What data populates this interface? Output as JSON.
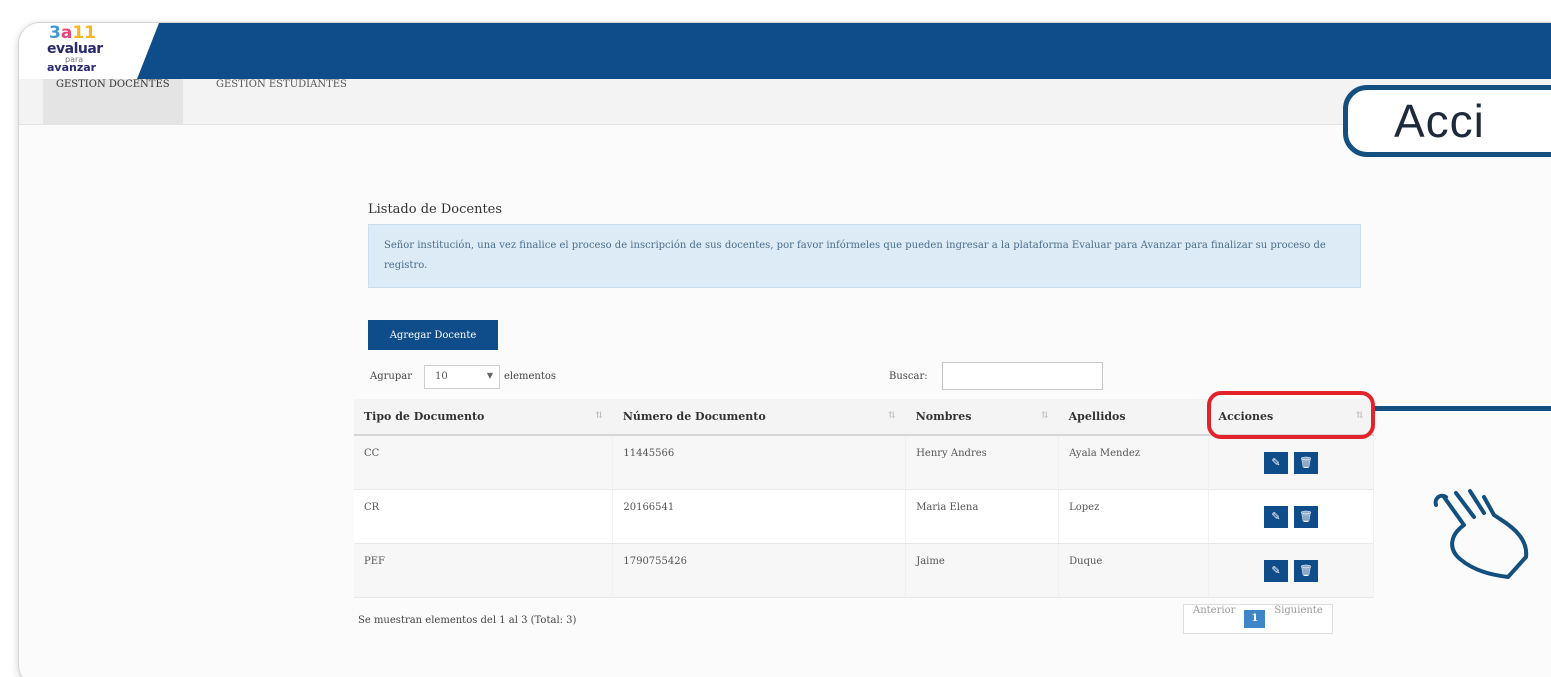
{
  "logo": {
    "line1_a": "3",
    "line1_b": "a",
    "line1_c": "11",
    "line2": "evaluar",
    "line3": "para",
    "line4": "avanzar"
  },
  "tabs": [
    {
      "label": "GESTION DOCENTES"
    },
    {
      "label": "GESTION ESTUDIANTES"
    }
  ],
  "callout_text": "Acci",
  "page_title": "Listado de Docentes",
  "notice": "Señor institución, una vez finalice el proceso de inscripción de sus docentes, por favor infórmeles que pueden ingresar a la plataforma Evaluar para Avanzar para finalizar su proceso de registro.",
  "add_button": "Agregar Docente",
  "group": {
    "label_before": "Agrupar",
    "value": "10",
    "label_after": "elementos"
  },
  "search_label": "Buscar:",
  "table": {
    "headers": [
      "Tipo de Documento",
      "Número de Documento",
      "Nombres",
      "Apellidos",
      "Acciones"
    ],
    "rows": [
      [
        "CC",
        "11445566",
        "Henry Andres",
        "Ayala Mendez"
      ],
      [
        "CR",
        "20166541",
        "Maria Elena",
        "Lopez"
      ],
      [
        "PEF",
        "1790755426",
        "Jaime",
        "Duque"
      ]
    ]
  },
  "footer_text": "Se muestran elementos del 1 al 3 (Total: 3)",
  "pager": {
    "prev": "Anterior",
    "current": "1",
    "next": "Siguiente"
  },
  "colors": {
    "brand_blue": "#0f4c8a",
    "highlight_red": "#e3232b",
    "notice_bg": "#dcebf6"
  }
}
